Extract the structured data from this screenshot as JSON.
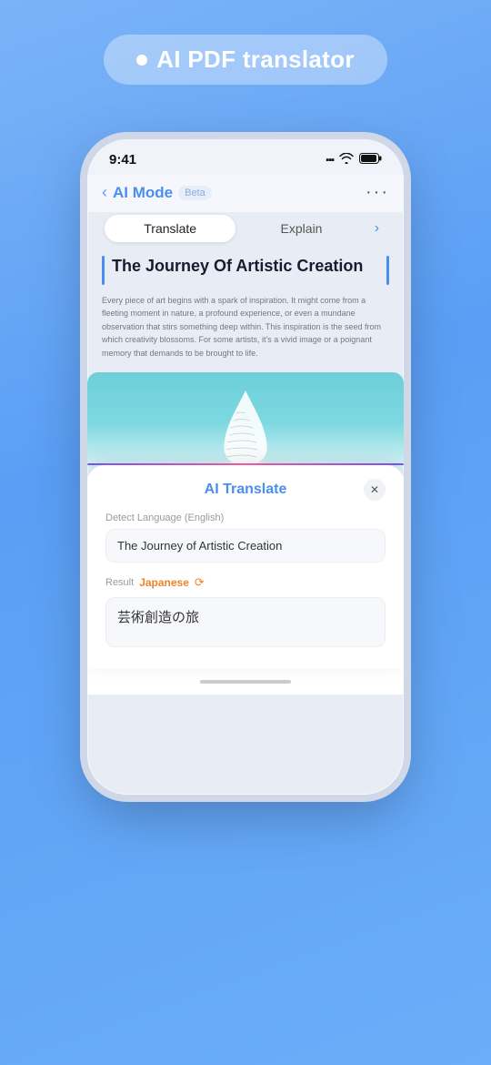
{
  "app": {
    "dot": "●",
    "title": "AI PDF translator"
  },
  "status_bar": {
    "time": "9:41",
    "signal": "▐▐▐",
    "wifi": "WiFi",
    "battery": "Battery"
  },
  "nav": {
    "back_icon": "‹",
    "title": "AI Mode",
    "badge": "Beta",
    "more_icon": "···"
  },
  "tabs": {
    "translate_label": "Translate",
    "explain_label": "Explain",
    "arrow": "›",
    "active": "translate"
  },
  "document": {
    "title": "The Journey Of Artistic Creation",
    "body": "Every piece of art begins with a spark of inspiration. It might come from a fleeting moment in nature, a profound experience, or even a mundane observation that stirs something deep within. This inspiration is the seed from which creativity blossoms. For some artists, it's a vivid image or a poignant memory that demands to be brought to life."
  },
  "translate_panel": {
    "title": "AI Translate",
    "close_icon": "✕",
    "detect_label": "Detect Language (English)",
    "source_text": "The Journey of Artistic Creation",
    "result_label": "Result",
    "result_lang": "Japanese",
    "result_lang_arrow": "⟳",
    "output_text": "芸術創造の旅"
  },
  "home_indicator": {
    "bar": ""
  }
}
